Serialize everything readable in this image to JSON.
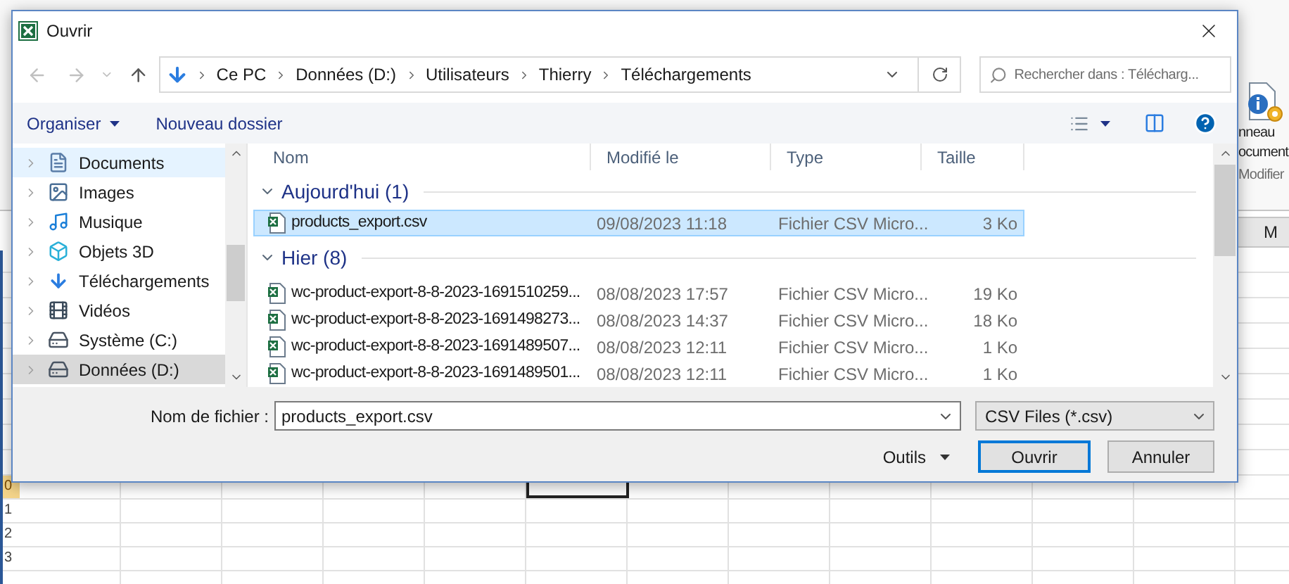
{
  "excel": {
    "ribbon_texts": [
      "nneau",
      "ocument",
      "Modifier"
    ],
    "column_header": "M",
    "row_numbers": [
      {
        "label": "0",
        "active": true
      },
      {
        "label": "1",
        "active": false
      },
      {
        "label": "2",
        "active": false
      },
      {
        "label": "3",
        "active": false
      }
    ]
  },
  "dialog": {
    "title": "Ouvrir",
    "breadcrumb": [
      "Ce PC",
      "Données (D:)",
      "Utilisateurs",
      "Thierry",
      "Téléchargements"
    ],
    "search": {
      "placeholder": "Rechercher dans : Télécharg..."
    },
    "toolbar": [
      {
        "label": "Organiser",
        "kind": "menu"
      },
      {
        "label": "Nouveau dossier",
        "kind": "button"
      }
    ],
    "sidebar": [
      {
        "label": "Documents",
        "kind": "documents",
        "selected": false,
        "hover": true
      },
      {
        "label": "Images",
        "kind": "images",
        "selected": false,
        "hover": false
      },
      {
        "label": "Musique",
        "kind": "music",
        "selected": false,
        "hover": false
      },
      {
        "label": "Objets 3D",
        "kind": "objects",
        "selected": false,
        "hover": false
      },
      {
        "label": "Téléchargements",
        "kind": "downloads",
        "selected": false,
        "hover": false
      },
      {
        "label": "Vidéos",
        "kind": "videos",
        "selected": false,
        "hover": false
      },
      {
        "label": "Système (C:)",
        "kind": "system",
        "selected": false,
        "hover": false
      },
      {
        "label": "Données (D:)",
        "kind": "drive",
        "selected": true,
        "hover": false
      }
    ],
    "columns": [
      "Nom",
      "Modifié le",
      "Type",
      "Taille"
    ],
    "groups": [
      {
        "label": "Aujourd'hui (1)",
        "expanded": true,
        "files": [
          {
            "name": "products_export.csv",
            "modified": "09/08/2023 11:18",
            "type": "Fichier CSV Micro...",
            "size": "3 Ko",
            "selected": true
          }
        ]
      },
      {
        "label": "Hier (8)",
        "expanded": true,
        "files": [
          {
            "name": "wc-product-export-8-8-2023-1691510259...",
            "modified": "08/08/2023 17:57",
            "type": "Fichier CSV Micro...",
            "size": "19 Ko",
            "selected": false
          },
          {
            "name": "wc-product-export-8-8-2023-1691498273...",
            "modified": "08/08/2023 14:37",
            "type": "Fichier CSV Micro...",
            "size": "18 Ko",
            "selected": false
          },
          {
            "name": "wc-product-export-8-8-2023-1691489507...",
            "modified": "08/08/2023 12:11",
            "type": "Fichier CSV Micro...",
            "size": "1 Ko",
            "selected": false
          },
          {
            "name": "wc-product-export-8-8-2023-1691489501...",
            "modified": "08/08/2023 12:11",
            "type": "Fichier CSV Micro...",
            "size": "1 Ko",
            "selected": false
          }
        ]
      }
    ],
    "filename_label": "Nom de fichier :",
    "filename": "products_export.csv",
    "filetype": "CSV Files (*.csv)",
    "buttons": [
      {
        "label": "Outils",
        "kind": "menu"
      },
      {
        "label": "Ouvrir",
        "kind": "default"
      },
      {
        "label": "Annuler",
        "kind": "normal"
      }
    ]
  }
}
